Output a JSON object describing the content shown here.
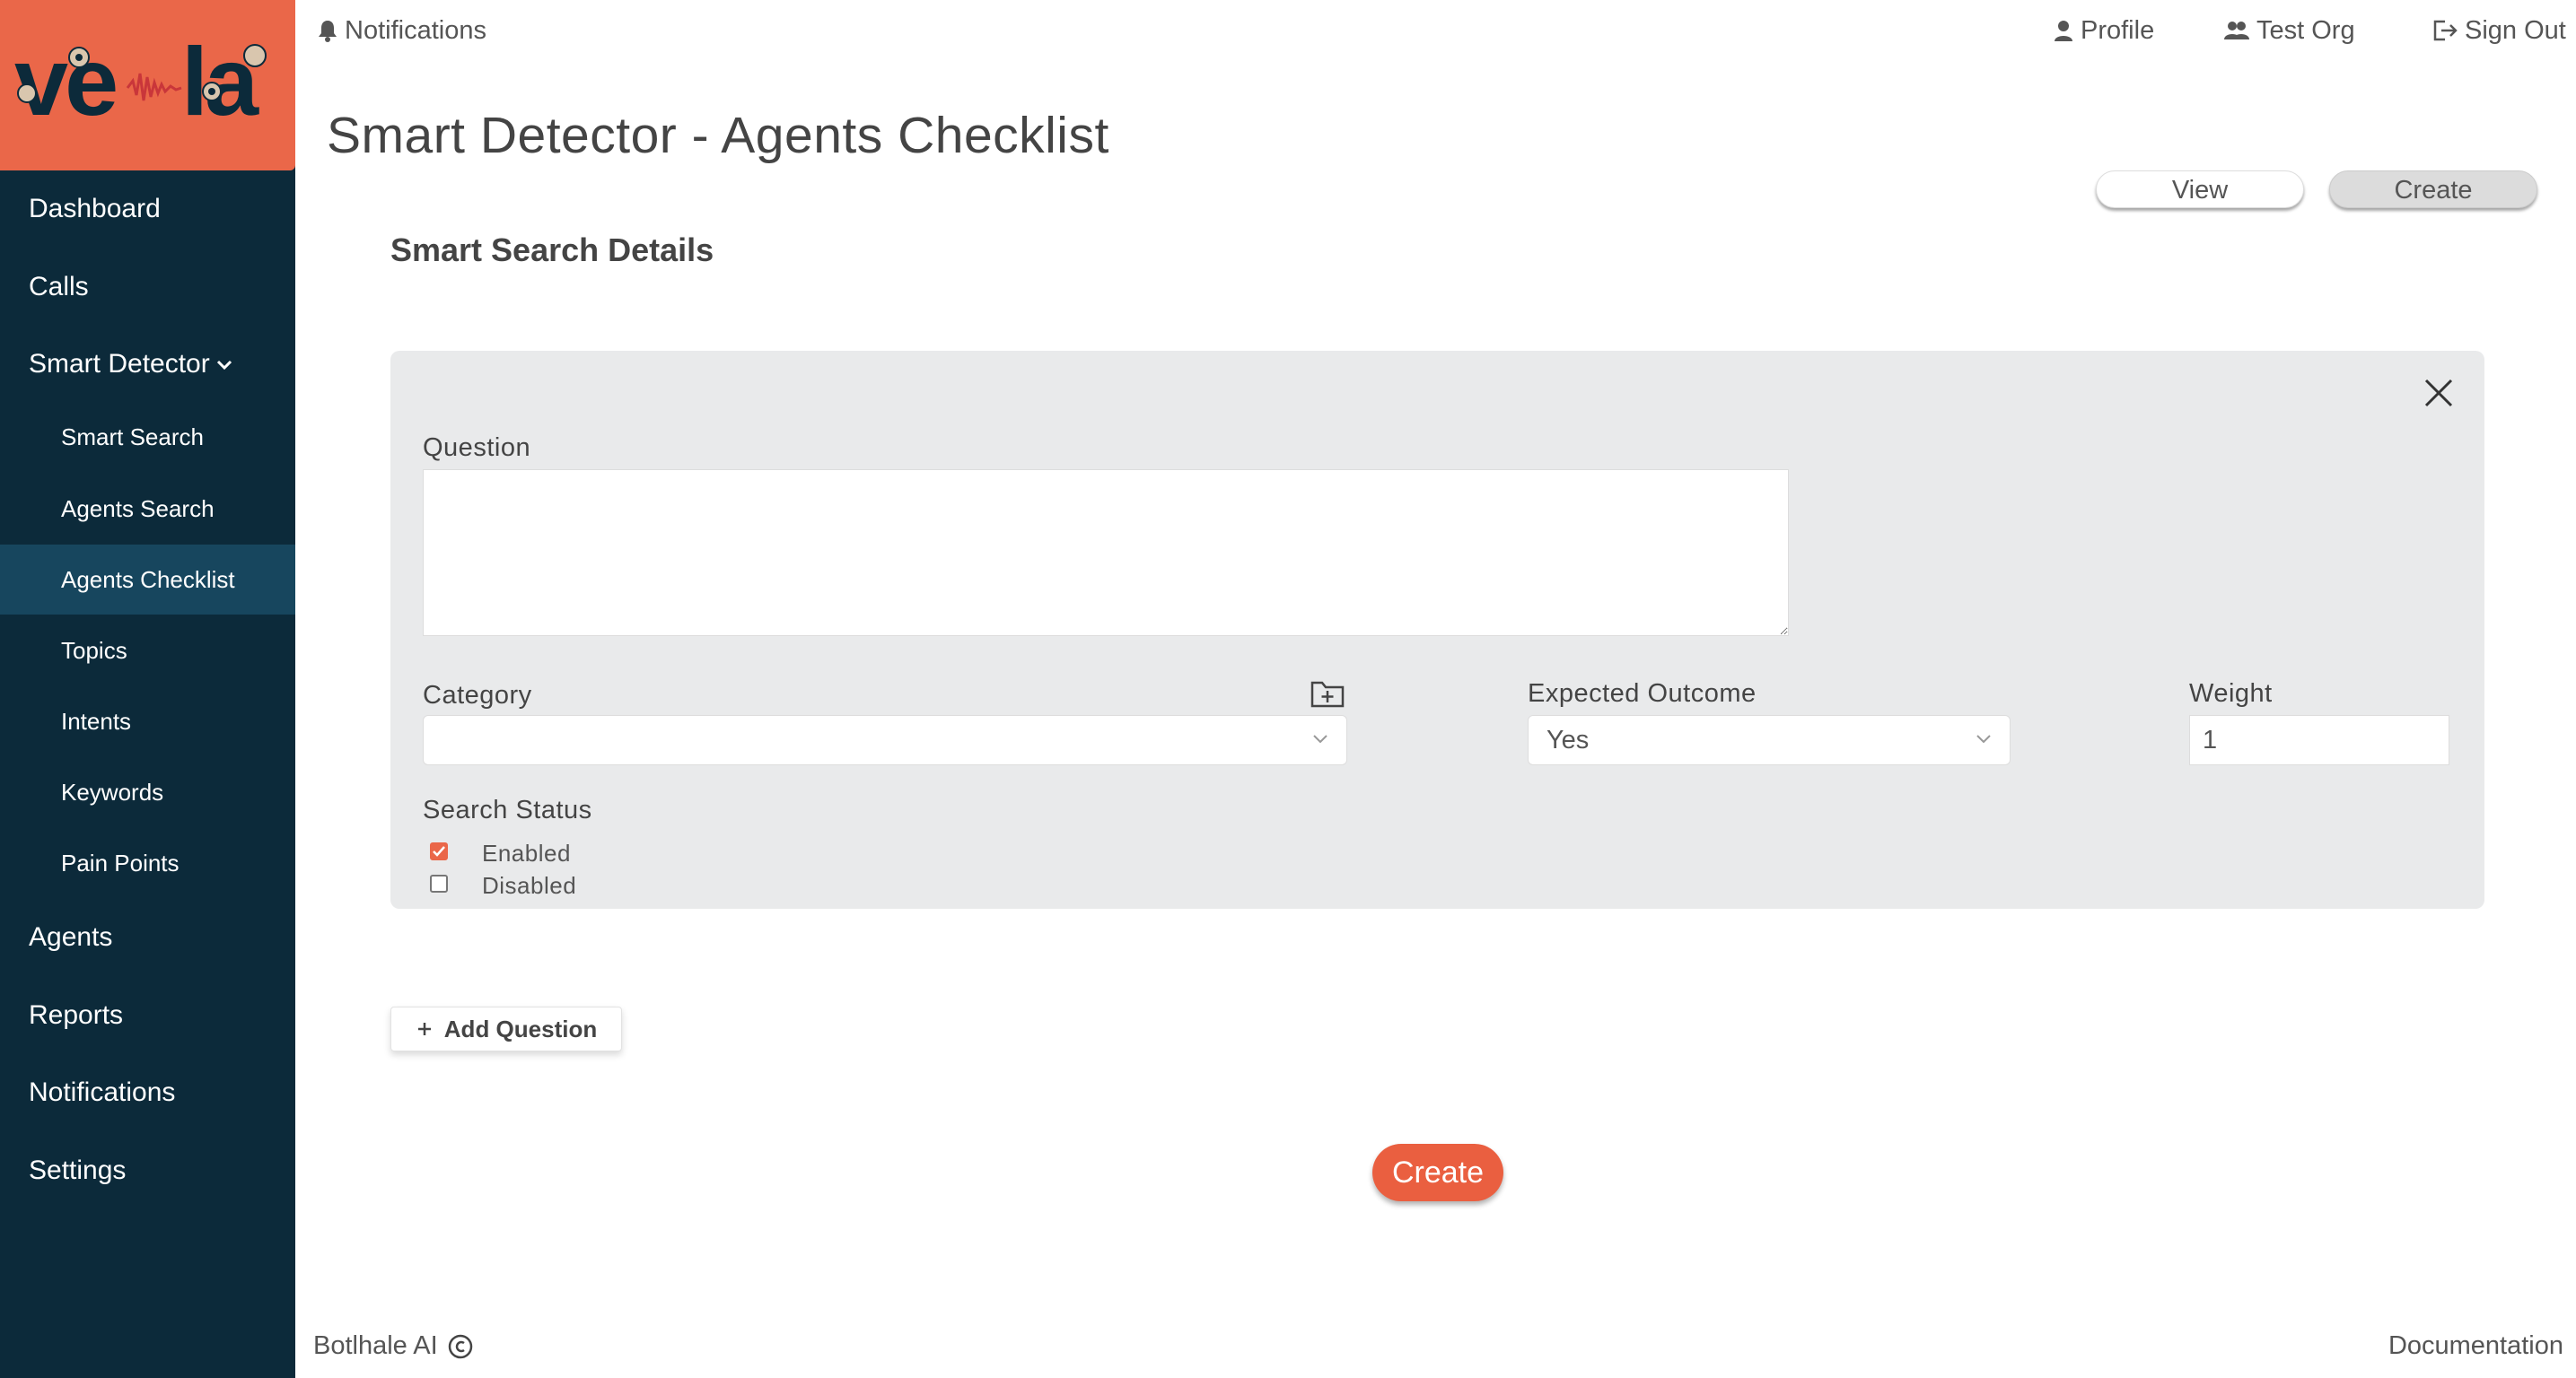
{
  "sidebar": {
    "items": [
      {
        "label": "Dashboard"
      },
      {
        "label": "Calls"
      },
      {
        "label": "Smart Detector"
      },
      {
        "label": "Smart Search"
      },
      {
        "label": "Agents Search"
      },
      {
        "label": "Agents Checklist"
      },
      {
        "label": "Topics"
      },
      {
        "label": "Intents"
      },
      {
        "label": "Keywords"
      },
      {
        "label": "Pain Points"
      },
      {
        "label": "Agents"
      },
      {
        "label": "Reports"
      },
      {
        "label": "Notifications"
      },
      {
        "label": "Settings"
      }
    ],
    "active_item": "Agents Checklist"
  },
  "topbar": {
    "notifications": "Notifications",
    "profile": "Profile",
    "org": "Test Org",
    "sign_out": "Sign Out"
  },
  "page": {
    "title": "Smart Detector - Agents Checklist",
    "view_label": "View",
    "create_mode_label": "Create",
    "section_title": "Smart Search Details"
  },
  "question_card": {
    "question_label": "Question",
    "question_value": "",
    "category_label": "Category",
    "category_value": "",
    "expected_outcome_label": "Expected Outcome",
    "expected_outcome_value": "Yes",
    "weight_label": "Weight",
    "weight_value": "1",
    "search_status_label": "Search Status",
    "enabled_label": "Enabled",
    "enabled_checked": true,
    "disabled_label": "Disabled",
    "disabled_checked": false
  },
  "actions": {
    "add_question_label": "Add Question",
    "create_label": "Create"
  },
  "footer": {
    "brand": "Botlhale AI",
    "documentation": "Documentation"
  },
  "colors": {
    "sidebar_bg": "#0c2a3a",
    "sidebar_active": "#17465e",
    "brand_orange": "#ea6749",
    "card_bg": "#e9eaeb"
  },
  "icons": [
    "bell-icon",
    "user-icon",
    "users-icon",
    "sign-out-icon",
    "chevron-down-icon",
    "close-icon",
    "folder-plus-icon",
    "plus-icon",
    "copyright-icon",
    "checkbox-checked-icon"
  ]
}
